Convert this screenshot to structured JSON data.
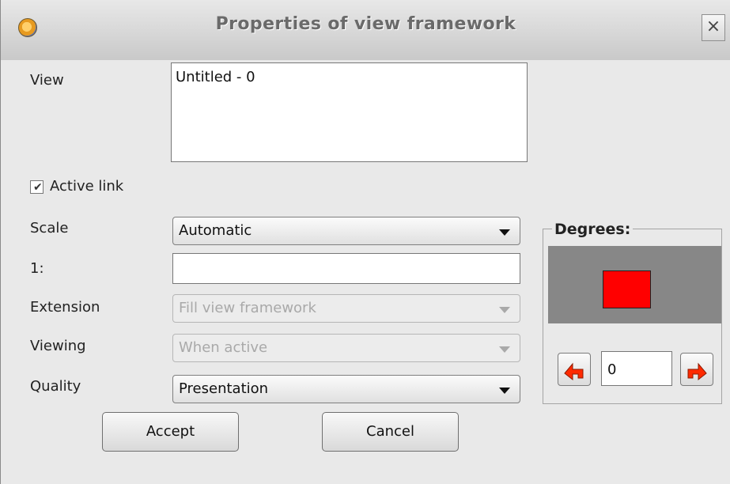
{
  "window": {
    "title": "Properties of view framework",
    "close_glyph": "×",
    "app_icon": "app-logo-icon"
  },
  "view": {
    "label": "View",
    "value": "Untitled - 0"
  },
  "active_link": {
    "label": "Active link",
    "checked": true,
    "check_glyph": "✔"
  },
  "fields": {
    "scale": {
      "label": "Scale",
      "value": "Automatic"
    },
    "ratio": {
      "label": "1:",
      "value": ""
    },
    "extension": {
      "label": "Extension",
      "value": "Fill view framework",
      "disabled": true
    },
    "viewing": {
      "label": "Viewing",
      "value": "When active",
      "disabled": true
    },
    "quality": {
      "label": "Quality",
      "value": "Presentation"
    }
  },
  "buttons": {
    "accept": "Accept",
    "cancel": "Cancel"
  },
  "degrees": {
    "title": "Degrees:",
    "value": "0",
    "preview_color": "#ff0000",
    "rotate_left_icon": "rotate-left-icon",
    "rotate_right_icon": "rotate-right-icon"
  }
}
